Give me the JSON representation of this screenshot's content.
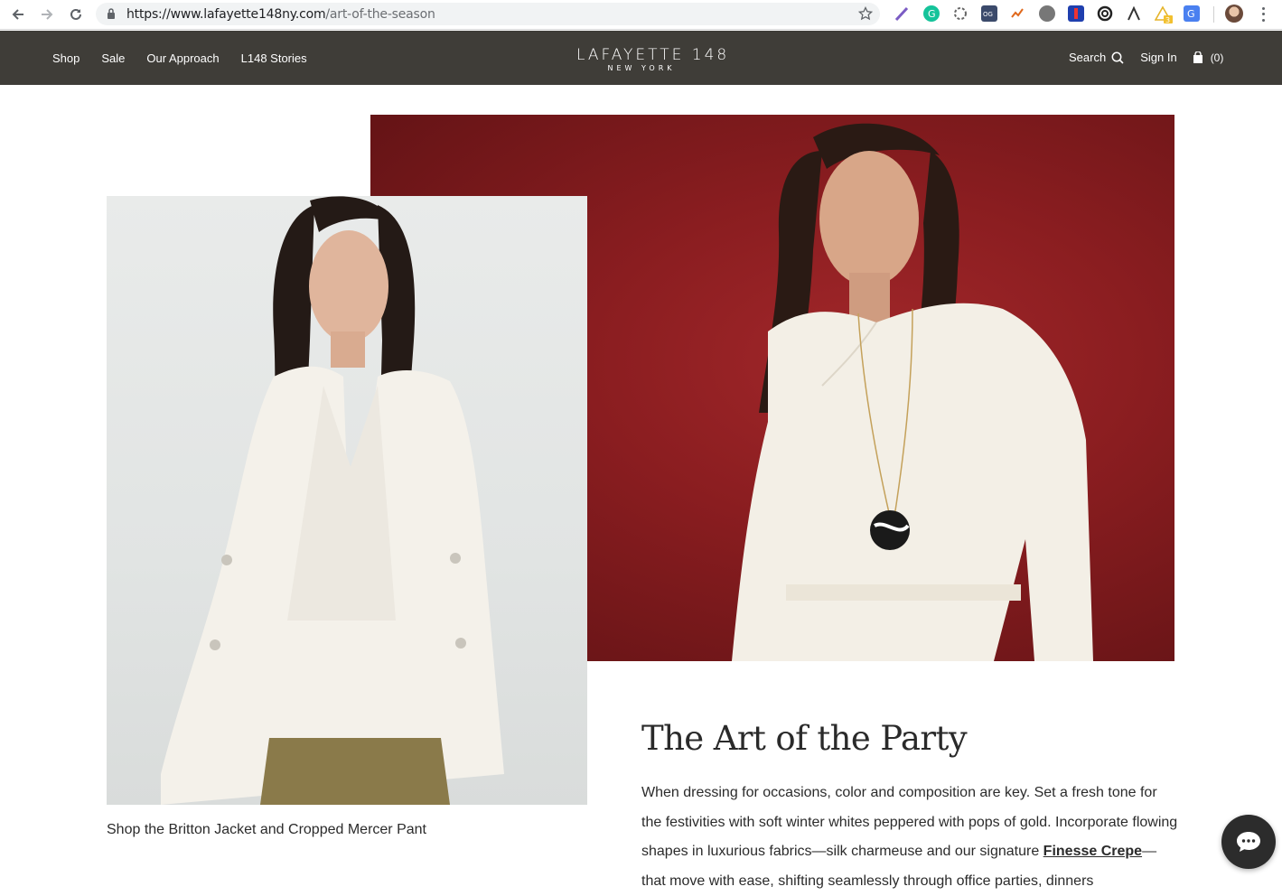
{
  "browser": {
    "url_domain": "https://www.lafayette148ny.com",
    "url_path": "/art-of-the-season",
    "extensions": [
      "quill-icon",
      "grammarly-icon",
      "gear-extension-icon",
      "og-icon",
      "chart-extension-icon",
      "globe-extension-icon",
      "bookmark-extension-icon",
      "spiral-extension-icon",
      "drafting-extension-icon",
      "warning-extension-icon",
      "google-translate-icon",
      "profile-avatar"
    ],
    "warning_badge": "3"
  },
  "header": {
    "nav": [
      {
        "label": "Shop"
      },
      {
        "label": "Sale"
      },
      {
        "label": "Our Approach"
      },
      {
        "label": "L148 Stories"
      }
    ],
    "logo_line1": "LAFAYETTE 148",
    "logo_line2": "NEW YORK",
    "search_label": "Search",
    "signin_label": "Sign In",
    "cart_count": "(0)"
  },
  "content": {
    "caption": "Shop the Britton Jacket and Cropped Mercer Pant",
    "headline": "The Art of the Party",
    "body_part1": "When dressing for occasions, color and composition are key. Set a fresh tone for the festivities with soft winter whites peppered with pops of gold. Incorporate flowing shapes in luxurious fabrics—silk charmeuse and our signature ",
    "body_link": "Finesse Crepe",
    "body_part2": "—that move with ease, shifting seamlessly through office parties, dinners"
  },
  "colors": {
    "header_bg": "#3f3d38",
    "hero_red": "#8a1d20",
    "text": "#2b2b2b"
  }
}
